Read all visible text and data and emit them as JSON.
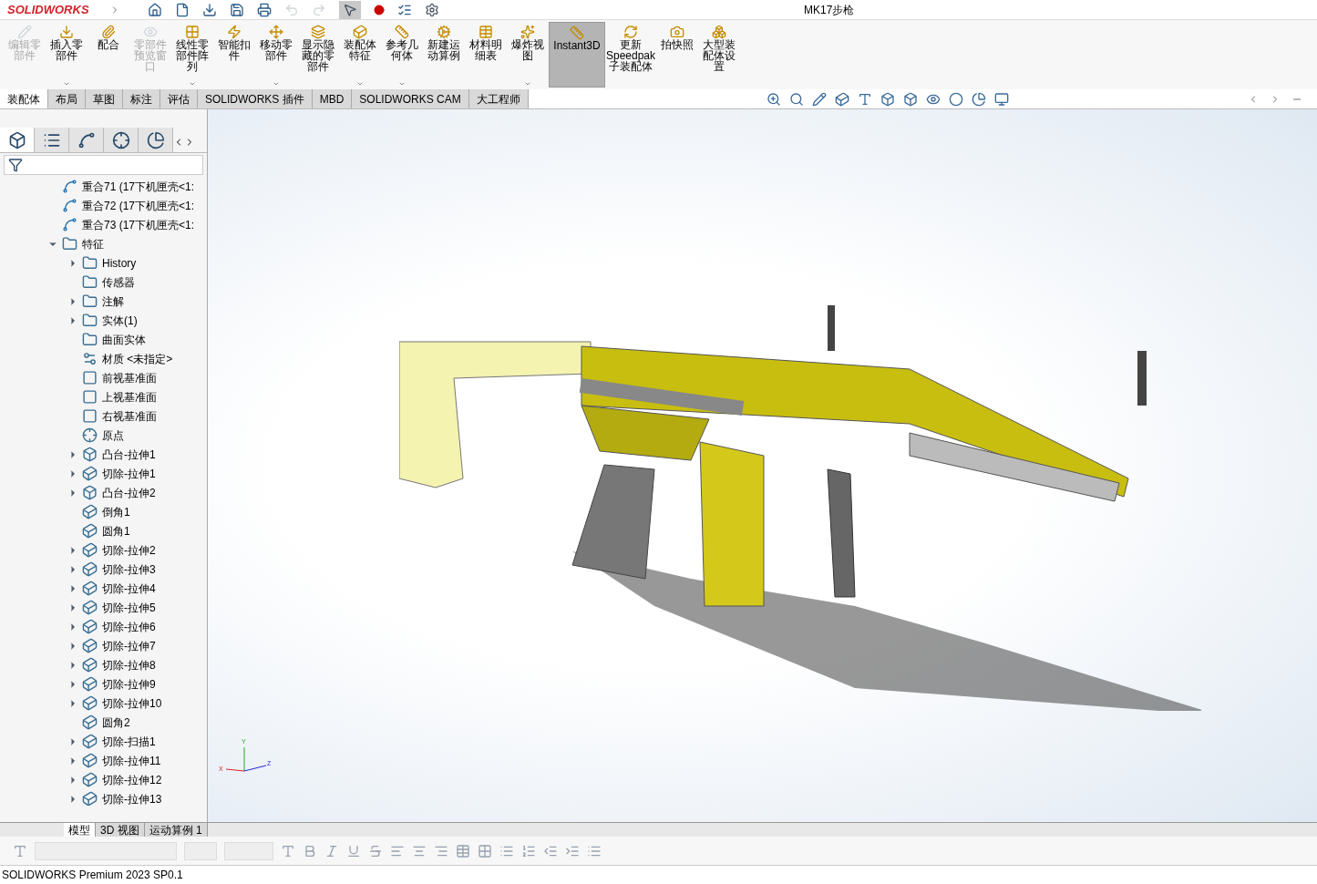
{
  "app": {
    "logo": "SOLIDWORKS",
    "title": "MK17步枪"
  },
  "ribbon": [
    {
      "label": "编辑零部件",
      "disabled": true,
      "menu": false,
      "selected": false
    },
    {
      "label": "插入零部件",
      "disabled": false,
      "menu": true,
      "selected": false
    },
    {
      "label": "配合",
      "disabled": false,
      "menu": false,
      "selected": false
    },
    {
      "label": "零部件预览窗口",
      "disabled": true,
      "menu": false,
      "selected": false
    },
    {
      "label": "线性零部件阵列",
      "disabled": false,
      "menu": true,
      "selected": false
    },
    {
      "label": "智能扣件",
      "disabled": false,
      "menu": false,
      "selected": false
    },
    {
      "label": "移动零部件",
      "disabled": false,
      "menu": true,
      "selected": false
    },
    {
      "label": "显示隐藏的零部件",
      "disabled": false,
      "menu": false,
      "selected": false
    },
    {
      "label": "装配体特征",
      "disabled": false,
      "menu": true,
      "selected": false
    },
    {
      "label": "参考几何体",
      "disabled": false,
      "menu": true,
      "selected": false
    },
    {
      "label": "新建运动算例",
      "disabled": false,
      "menu": false,
      "selected": false
    },
    {
      "label": "材料明细表",
      "disabled": false,
      "menu": false,
      "selected": false
    },
    {
      "label": "爆炸视图",
      "disabled": false,
      "menu": true,
      "selected": false
    },
    {
      "label": "Instant3D",
      "disabled": false,
      "menu": false,
      "selected": true
    },
    {
      "label": "更新Speedpak子装配体",
      "disabled": false,
      "menu": false,
      "selected": false
    },
    {
      "label": "拍快照",
      "disabled": false,
      "menu": false,
      "selected": false
    },
    {
      "label": "大型装配体设置",
      "disabled": false,
      "menu": false,
      "selected": false
    }
  ],
  "tabs": [
    {
      "label": "装配体",
      "selected": true
    },
    {
      "label": "布局",
      "selected": false
    },
    {
      "label": "草图",
      "selected": false
    },
    {
      "label": "标注",
      "selected": false
    },
    {
      "label": "评估",
      "selected": false
    },
    {
      "label": "SOLIDWORKS 插件",
      "selected": false
    },
    {
      "label": "MBD",
      "selected": false
    },
    {
      "label": "SOLIDWORKS CAM",
      "selected": false
    },
    {
      "label": "大工程师",
      "selected": false
    }
  ],
  "panel_tabs": [
    {
      "selected": true
    },
    {
      "selected": false
    },
    {
      "selected": false
    },
    {
      "selected": false
    },
    {
      "selected": false
    }
  ],
  "tree": [
    {
      "kind": "mate",
      "label": "重合71 (17下机匣壳<1:"
    },
    {
      "kind": "mate",
      "label": "重合72 (17下机匣壳<1:"
    },
    {
      "kind": "mate",
      "label": "重合73 (17下机匣壳<1:"
    },
    {
      "kind": "folder",
      "label": "特征",
      "expanded": true,
      "children": [
        {
          "kind": "folder",
          "label": "History",
          "expanded": false
        },
        {
          "kind": "folder",
          "label": "传感器"
        },
        {
          "kind": "folder",
          "label": "注解",
          "expanded": false
        },
        {
          "kind": "folder",
          "label": "实体(1)",
          "expanded": false
        },
        {
          "kind": "folder",
          "label": "曲面实体"
        },
        {
          "kind": "material",
          "label": "材质 <未指定>"
        },
        {
          "kind": "plane",
          "label": "前视基准面"
        },
        {
          "kind": "plane",
          "label": "上视基准面"
        },
        {
          "kind": "plane",
          "label": "右视基准面"
        },
        {
          "kind": "origin",
          "label": "原点"
        },
        {
          "kind": "boss",
          "label": "凸台-拉伸1",
          "expanded": false
        },
        {
          "kind": "cut",
          "label": "切除-拉伸1",
          "expanded": false
        },
        {
          "kind": "boss",
          "label": "凸台-拉伸2",
          "expanded": false
        },
        {
          "kind": "fillet",
          "label": "倒角1"
        },
        {
          "kind": "fillet",
          "label": "圆角1"
        },
        {
          "kind": "cut",
          "label": "切除-拉伸2",
          "expanded": false
        },
        {
          "kind": "cut",
          "label": "切除-拉伸3",
          "expanded": false
        },
        {
          "kind": "cut",
          "label": "切除-拉伸4",
          "expanded": false
        },
        {
          "kind": "cut",
          "label": "切除-拉伸5",
          "expanded": false
        },
        {
          "kind": "cut",
          "label": "切除-拉伸6",
          "expanded": false
        },
        {
          "kind": "cut",
          "label": "切除-拉伸7",
          "expanded": false
        },
        {
          "kind": "cut",
          "label": "切除-拉伸8",
          "expanded": false
        },
        {
          "kind": "cut",
          "label": "切除-拉伸9",
          "expanded": false
        },
        {
          "kind": "cut",
          "label": "切除-拉伸10",
          "expanded": false
        },
        {
          "kind": "fillet",
          "label": "圆角2"
        },
        {
          "kind": "sweep",
          "label": "切除-扫描1",
          "expanded": false
        },
        {
          "kind": "cut",
          "label": "切除-拉伸11",
          "expanded": false
        },
        {
          "kind": "cut",
          "label": "切除-拉伸12",
          "expanded": false
        },
        {
          "kind": "cut",
          "label": "切除-拉伸13",
          "expanded": false
        }
      ]
    }
  ],
  "triad": {
    "y": "Y",
    "x": "X",
    "z": "Z"
  },
  "bottom_tabs": [
    {
      "label": "模型",
      "selected": true
    },
    {
      "label": "3D 视图",
      "selected": false
    },
    {
      "label": "运动算例 1",
      "selected": false
    }
  ],
  "status_bar": "SOLIDWORKS Premium 2023 SP0.1"
}
